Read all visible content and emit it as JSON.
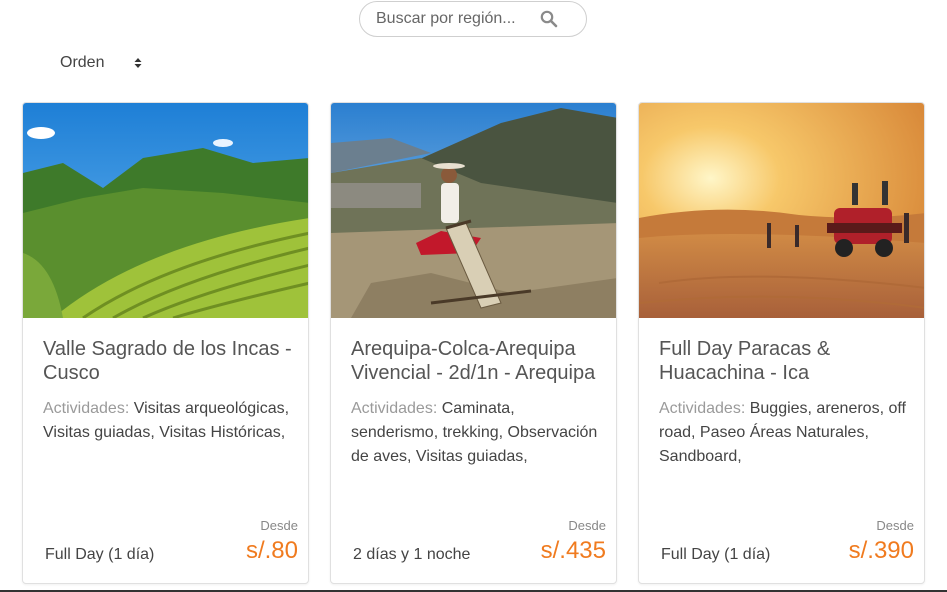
{
  "search": {
    "placeholder": "Buscar por región..."
  },
  "sort": {
    "label": "Orden"
  },
  "cards": [
    {
      "title": "Valle Sagrado de los Incas - Cusco",
      "activities_label": "Actividades:",
      "activities": "Visitas arqueológicas, Visitas guiadas, Visitas Históricas,",
      "from_label": "Desde",
      "duration": "Full Day (1 día)",
      "price": "s/.80"
    },
    {
      "title": "Arequipa-Colca-Arequipa Vivencial - 2d/1n - Arequipa",
      "activities_label": "Actividades:",
      "activities": "Caminata, senderismo, trekking, Observación de aves, Visitas guiadas,",
      "from_label": "Desde",
      "duration": "2 días y 1 noche",
      "price": "s/.435"
    },
    {
      "title": "Full Day Paracas & Huacachina - Ica",
      "activities_label": "Actividades:",
      "activities": "Buggies, areneros, off road, Paseo Áreas Naturales, Sandboard,",
      "from_label": "Desde",
      "duration": "Full Day (1 día)",
      "price": "s/.390"
    }
  ],
  "colors": {
    "price": "#f07b1f",
    "border": "#e0e0e0"
  }
}
